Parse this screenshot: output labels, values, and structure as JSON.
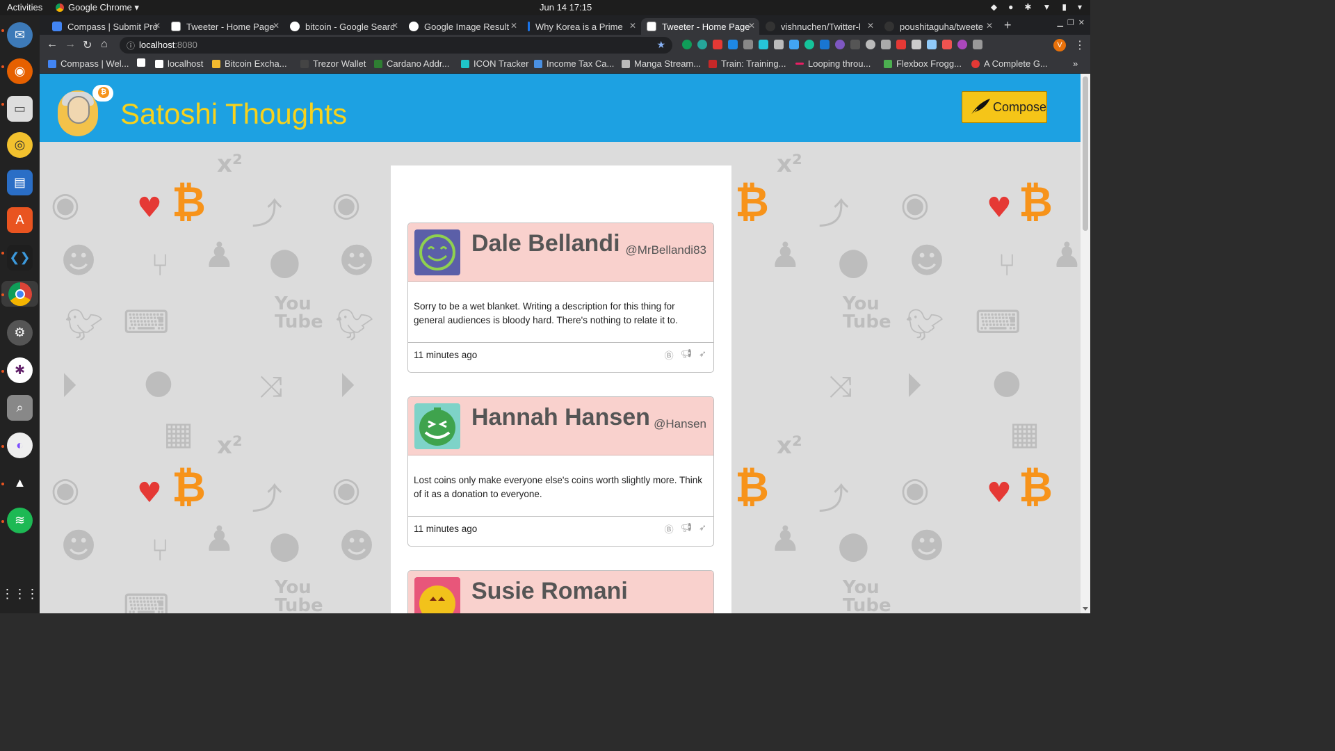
{
  "system": {
    "activities": "Activities",
    "app_name": "Google Chrome ▾",
    "clock": "Jun 14  17:15"
  },
  "browser": {
    "tabs": [
      {
        "title": "Compass | Submit Pro",
        "active": false
      },
      {
        "title": "Tweeter - Home Page",
        "active": false
      },
      {
        "title": "bitcoin - Google Searc",
        "active": false
      },
      {
        "title": "Google Image Result",
        "active": false
      },
      {
        "title": "Why Korea is a Prime",
        "active": false
      },
      {
        "title": "Tweeter - Home Page",
        "active": true
      },
      {
        "title": "vishnuchen/Twitter-l",
        "active": false
      },
      {
        "title": "poushitaguha/tweete",
        "active": false
      }
    ],
    "url_host": "localhost",
    "url_port": ":8080",
    "profile_initial": "V",
    "bookmarks": [
      "Compass | Wel...",
      "",
      "localhost",
      "Bitcoin Excha...",
      "Trezor Wallet",
      "Cardano Addr...",
      "ICON Tracker",
      "Income Tax Ca...",
      "Manga Stream...",
      "Train: Training...",
      "Looping throu...",
      "Flexbox Frogg...",
      "A Complete G..."
    ],
    "bookmarks_more": "»"
  },
  "site": {
    "title": "Satoshi Thoughts",
    "compose_label": "Compose",
    "accent": "#1da1e2",
    "title_color": "#f7d21c"
  },
  "tweets": [
    {
      "name": "Dale Bellandi",
      "handle": "@MrBellandi83",
      "text": "Sorry to be a wet blanket. Writing a description for this thing for general audiences is bloody hard. There's nothing to relate it to.",
      "time": "11 minutes ago",
      "avatar_color": "#5b5fa8"
    },
    {
      "name": "Hannah Hansen",
      "handle": "@Hansen",
      "text": "Lost coins only make everyone else's coins worth slightly more. Think of it as a donation to everyone.",
      "time": "11 minutes ago",
      "avatar_color": "#7ed3c8"
    },
    {
      "name": "Susie Romani",
      "handle": "",
      "text": "",
      "time": "",
      "avatar_color": "#e8567a"
    }
  ]
}
